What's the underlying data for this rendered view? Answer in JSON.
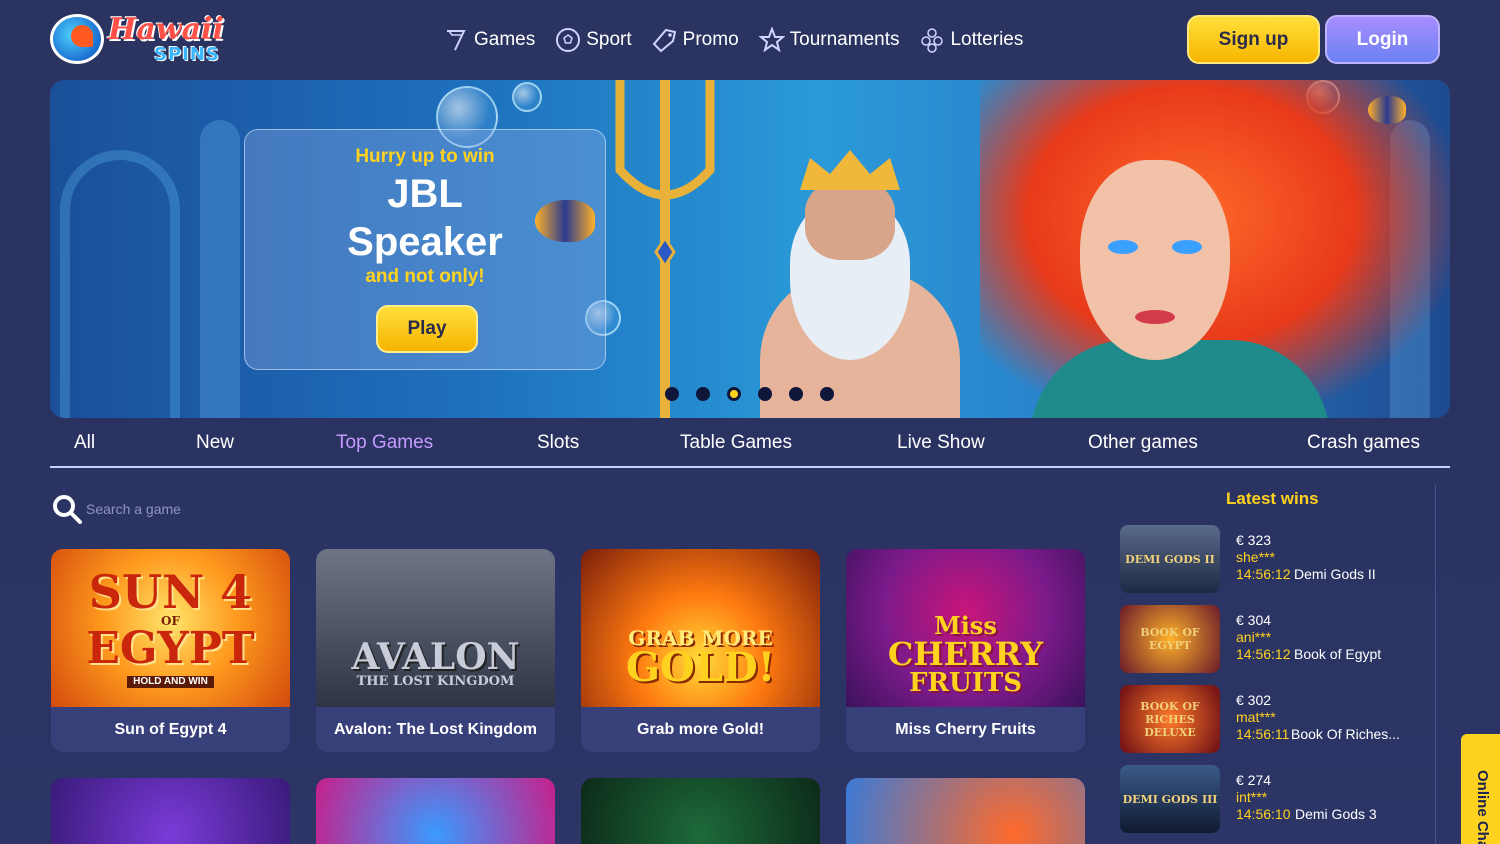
{
  "logo": {
    "line1": "Hawaii",
    "line2": "SPINS"
  },
  "nav": [
    {
      "label": "Games",
      "icon": "seven-icon"
    },
    {
      "label": "Sport",
      "icon": "soccer-ball-icon"
    },
    {
      "label": "Promo",
      "icon": "tag-icon"
    },
    {
      "label": "Tournaments",
      "icon": "star-icon"
    },
    {
      "label": "Lotteries",
      "icon": "lottery-balls-icon"
    }
  ],
  "auth": {
    "signup": "Sign up",
    "login": "Login"
  },
  "banner": {
    "subtitle": "Hurry up to win",
    "title_line1": "JBL",
    "title_line2": "Speaker",
    "note": "and not only!",
    "play": "Play",
    "slides": 6,
    "active_slide": 3
  },
  "tabs": [
    {
      "label": "All"
    },
    {
      "label": "New"
    },
    {
      "label": "Top Games",
      "active": true
    },
    {
      "label": "Slots"
    },
    {
      "label": "Table Games"
    },
    {
      "label": "Live Show"
    },
    {
      "label": "Other games"
    },
    {
      "label": "Crash games"
    }
  ],
  "search": {
    "placeholder": "Search a game"
  },
  "games": [
    {
      "name": "Sun of Egypt 4",
      "art_line1": "SUN 4",
      "art_line2": "EGYPT",
      "art_small1": "OF",
      "art_small2": "HOLD AND WIN"
    },
    {
      "name": "Avalon: The Lost Kingdom",
      "art_line1": "AVALON",
      "art_small1": "THE LOST KINGDOM"
    },
    {
      "name": "Grab more Gold!",
      "art_line1": "GRAB MORE",
      "art_line2": "GOLD!"
    },
    {
      "name": "Miss Cherry Fruits",
      "art_line1": "Miss",
      "art_line2": "CHERRY",
      "art_line3": "FRUITS"
    }
  ],
  "latest_wins": {
    "title": "Latest wins",
    "items": [
      {
        "amount": "€ 323",
        "user": "she***",
        "time": "14:56:12",
        "game": "Demi Gods II",
        "thumb_text": "DEMI GODS II"
      },
      {
        "amount": "€ 304",
        "user": "ani***",
        "time": "14:56:12",
        "game": "Book of Egypt",
        "thumb_text": "BOOK OF EGYPT"
      },
      {
        "amount": "€ 302",
        "user": "mat***",
        "time": "14:56:11",
        "game": "Book Of Riches...",
        "thumb_text": "BOOK OF RICHES DELUXE"
      },
      {
        "amount": "€ 274",
        "user": "int***",
        "time": "14:56:10",
        "game": "Demi Gods 3",
        "thumb_text": "DEMI GODS III"
      }
    ]
  },
  "online_chat": "Online Chat",
  "colors": {
    "accent_yellow": "#ffd21f",
    "accent_purple": "#c59bff",
    "background": "#2b3361",
    "login": "#7b84f4"
  }
}
